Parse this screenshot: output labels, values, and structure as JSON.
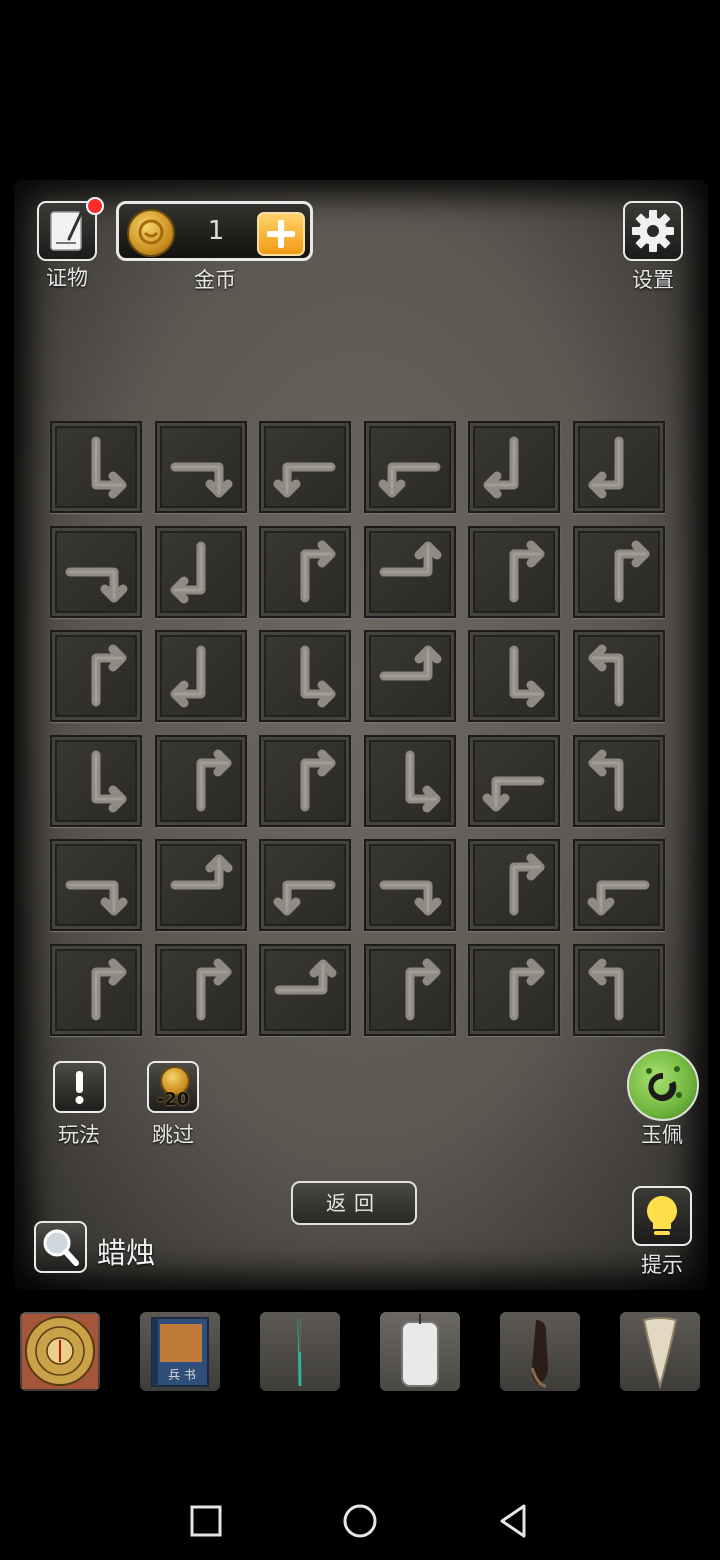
{
  "header": {
    "evidence_label": "证物",
    "coin_count": "1",
    "coin_label": "金币",
    "settings_label": "设置"
  },
  "puzzle": {
    "rows": [
      [
        "down-right",
        "right-down",
        "left-down",
        "left-down",
        "down-left",
        "down-left"
      ],
      [
        "right-down",
        "down-left",
        "up-right",
        "right-up",
        "up-right",
        "up-right"
      ],
      [
        "up-right",
        "down-left",
        "down-right",
        "right-up",
        "down-right",
        "up-left"
      ],
      [
        "down-right",
        "up-right",
        "up-right",
        "down-right",
        "left-down",
        "up-left"
      ],
      [
        "right-down",
        "right-up",
        "left-down",
        "right-down",
        "up-right",
        "left-down"
      ],
      [
        "up-right",
        "up-right",
        "right-up",
        "up-right",
        "up-right",
        "up-left"
      ]
    ]
  },
  "actions": {
    "rules_label": "玩法",
    "skip_label": "跳过",
    "skip_cost": "-20",
    "jade_label": "玉佩",
    "back_label": "返回",
    "hint_label": "提示",
    "search_item": "蜡烛"
  },
  "inventory": [
    {
      "name": "compass-item"
    },
    {
      "name": "war-book-item",
      "text": "兵 书"
    },
    {
      "name": "dagger-item"
    },
    {
      "name": "candle-item"
    },
    {
      "name": "brush-item"
    },
    {
      "name": "horn-item"
    }
  ],
  "colors": {
    "background": "#000000",
    "panel": "#5b5751",
    "tile": "#2f2e2b",
    "arrow": "#8f8b83",
    "coin": "#e2a82a",
    "hint": "#ffe04a",
    "jade": "#7bbf4a",
    "notification": "#ff2a2a"
  }
}
